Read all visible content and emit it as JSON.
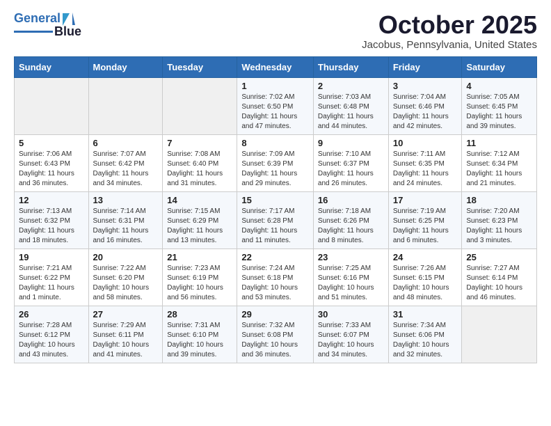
{
  "header": {
    "logo_line1": "General",
    "logo_line2": "Blue",
    "month": "October 2025",
    "location": "Jacobus, Pennsylvania, United States"
  },
  "weekdays": [
    "Sunday",
    "Monday",
    "Tuesday",
    "Wednesday",
    "Thursday",
    "Friday",
    "Saturday"
  ],
  "weeks": [
    [
      {
        "day": "",
        "info": ""
      },
      {
        "day": "",
        "info": ""
      },
      {
        "day": "",
        "info": ""
      },
      {
        "day": "1",
        "info": "Sunrise: 7:02 AM\nSunset: 6:50 PM\nDaylight: 11 hours\nand 47 minutes."
      },
      {
        "day": "2",
        "info": "Sunrise: 7:03 AM\nSunset: 6:48 PM\nDaylight: 11 hours\nand 44 minutes."
      },
      {
        "day": "3",
        "info": "Sunrise: 7:04 AM\nSunset: 6:46 PM\nDaylight: 11 hours\nand 42 minutes."
      },
      {
        "day": "4",
        "info": "Sunrise: 7:05 AM\nSunset: 6:45 PM\nDaylight: 11 hours\nand 39 minutes."
      }
    ],
    [
      {
        "day": "5",
        "info": "Sunrise: 7:06 AM\nSunset: 6:43 PM\nDaylight: 11 hours\nand 36 minutes."
      },
      {
        "day": "6",
        "info": "Sunrise: 7:07 AM\nSunset: 6:42 PM\nDaylight: 11 hours\nand 34 minutes."
      },
      {
        "day": "7",
        "info": "Sunrise: 7:08 AM\nSunset: 6:40 PM\nDaylight: 11 hours\nand 31 minutes."
      },
      {
        "day": "8",
        "info": "Sunrise: 7:09 AM\nSunset: 6:39 PM\nDaylight: 11 hours\nand 29 minutes."
      },
      {
        "day": "9",
        "info": "Sunrise: 7:10 AM\nSunset: 6:37 PM\nDaylight: 11 hours\nand 26 minutes."
      },
      {
        "day": "10",
        "info": "Sunrise: 7:11 AM\nSunset: 6:35 PM\nDaylight: 11 hours\nand 24 minutes."
      },
      {
        "day": "11",
        "info": "Sunrise: 7:12 AM\nSunset: 6:34 PM\nDaylight: 11 hours\nand 21 minutes."
      }
    ],
    [
      {
        "day": "12",
        "info": "Sunrise: 7:13 AM\nSunset: 6:32 PM\nDaylight: 11 hours\nand 18 minutes."
      },
      {
        "day": "13",
        "info": "Sunrise: 7:14 AM\nSunset: 6:31 PM\nDaylight: 11 hours\nand 16 minutes."
      },
      {
        "day": "14",
        "info": "Sunrise: 7:15 AM\nSunset: 6:29 PM\nDaylight: 11 hours\nand 13 minutes."
      },
      {
        "day": "15",
        "info": "Sunrise: 7:17 AM\nSunset: 6:28 PM\nDaylight: 11 hours\nand 11 minutes."
      },
      {
        "day": "16",
        "info": "Sunrise: 7:18 AM\nSunset: 6:26 PM\nDaylight: 11 hours\nand 8 minutes."
      },
      {
        "day": "17",
        "info": "Sunrise: 7:19 AM\nSunset: 6:25 PM\nDaylight: 11 hours\nand 6 minutes."
      },
      {
        "day": "18",
        "info": "Sunrise: 7:20 AM\nSunset: 6:23 PM\nDaylight: 11 hours\nand 3 minutes."
      }
    ],
    [
      {
        "day": "19",
        "info": "Sunrise: 7:21 AM\nSunset: 6:22 PM\nDaylight: 11 hours\nand 1 minute."
      },
      {
        "day": "20",
        "info": "Sunrise: 7:22 AM\nSunset: 6:20 PM\nDaylight: 10 hours\nand 58 minutes."
      },
      {
        "day": "21",
        "info": "Sunrise: 7:23 AM\nSunset: 6:19 PM\nDaylight: 10 hours\nand 56 minutes."
      },
      {
        "day": "22",
        "info": "Sunrise: 7:24 AM\nSunset: 6:18 PM\nDaylight: 10 hours\nand 53 minutes."
      },
      {
        "day": "23",
        "info": "Sunrise: 7:25 AM\nSunset: 6:16 PM\nDaylight: 10 hours\nand 51 minutes."
      },
      {
        "day": "24",
        "info": "Sunrise: 7:26 AM\nSunset: 6:15 PM\nDaylight: 10 hours\nand 48 minutes."
      },
      {
        "day": "25",
        "info": "Sunrise: 7:27 AM\nSunset: 6:14 PM\nDaylight: 10 hours\nand 46 minutes."
      }
    ],
    [
      {
        "day": "26",
        "info": "Sunrise: 7:28 AM\nSunset: 6:12 PM\nDaylight: 10 hours\nand 43 minutes."
      },
      {
        "day": "27",
        "info": "Sunrise: 7:29 AM\nSunset: 6:11 PM\nDaylight: 10 hours\nand 41 minutes."
      },
      {
        "day": "28",
        "info": "Sunrise: 7:31 AM\nSunset: 6:10 PM\nDaylight: 10 hours\nand 39 minutes."
      },
      {
        "day": "29",
        "info": "Sunrise: 7:32 AM\nSunset: 6:08 PM\nDaylight: 10 hours\nand 36 minutes."
      },
      {
        "day": "30",
        "info": "Sunrise: 7:33 AM\nSunset: 6:07 PM\nDaylight: 10 hours\nand 34 minutes."
      },
      {
        "day": "31",
        "info": "Sunrise: 7:34 AM\nSunset: 6:06 PM\nDaylight: 10 hours\nand 32 minutes."
      },
      {
        "day": "",
        "info": ""
      }
    ]
  ]
}
